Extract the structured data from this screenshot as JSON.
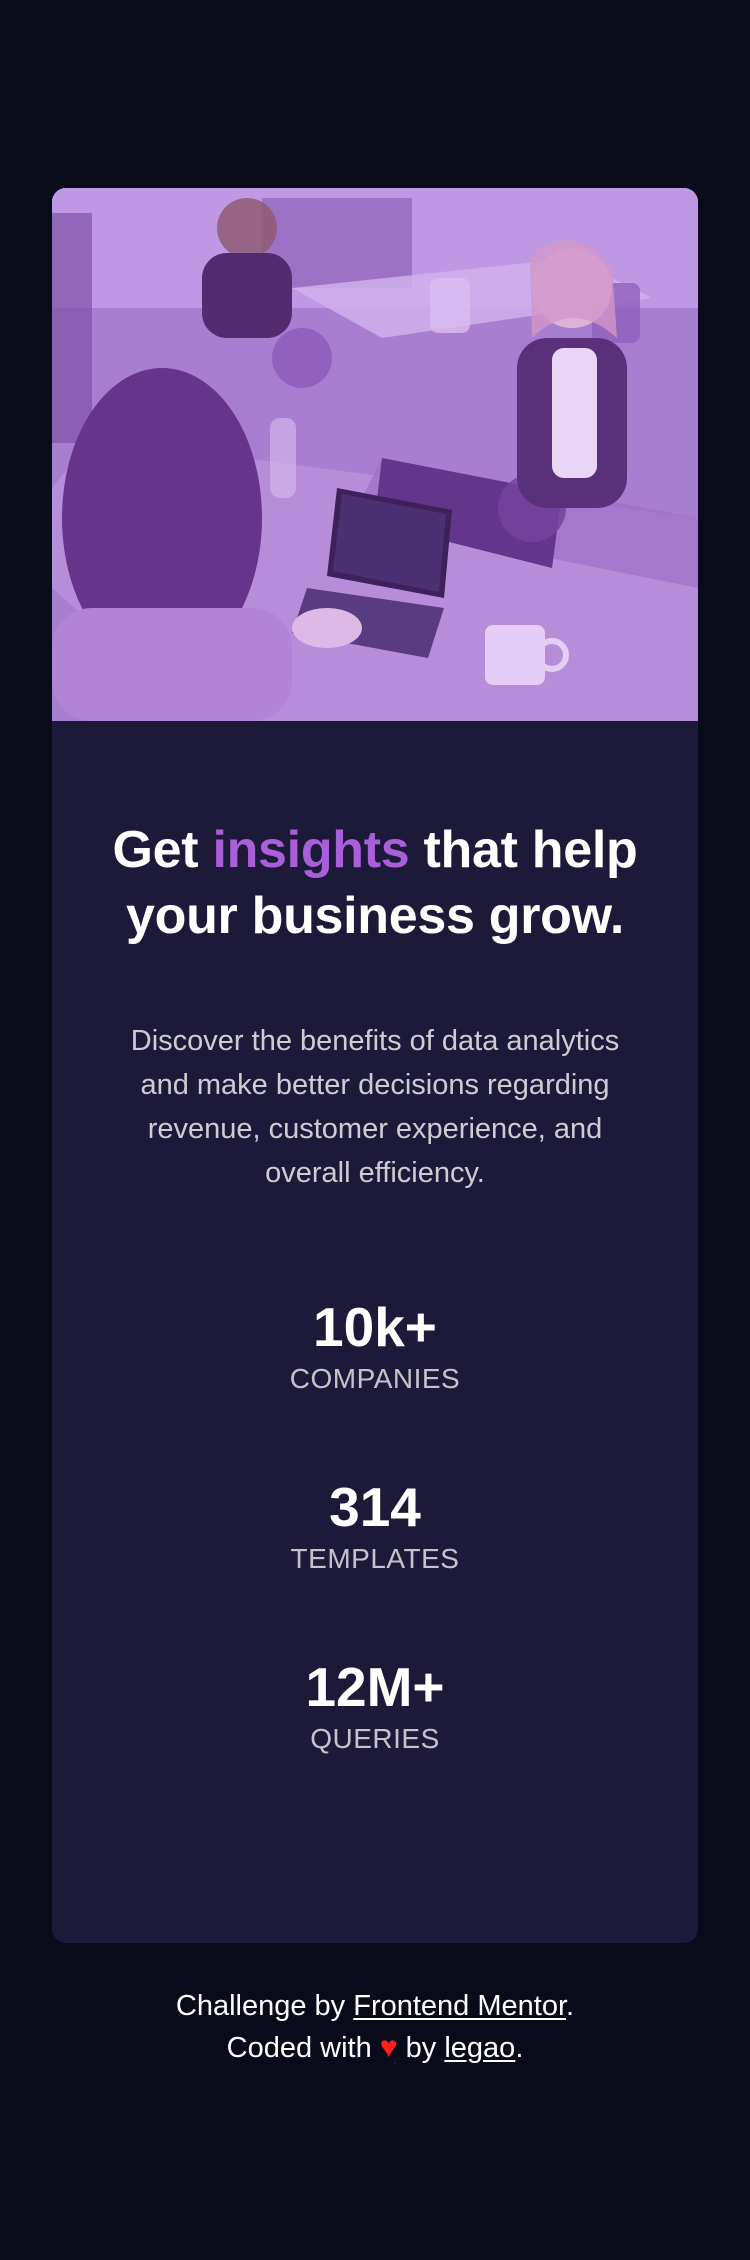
{
  "hero": {
    "image_alt": "Three people working at a table with laptops and plants"
  },
  "headline": {
    "part1": "Get ",
    "accent": "insights",
    "part2": " that help your business grow."
  },
  "description": "Discover the benefits of data analytics and make better decisions regarding revenue, customer experience, and overall efficiency.",
  "stats": [
    {
      "value": "10k+",
      "label": "COMPANIES"
    },
    {
      "value": "314",
      "label": "TEMPLATES"
    },
    {
      "value": "12M+",
      "label": "QUERIES"
    }
  ],
  "footer": {
    "line1_prefix": "Challenge by ",
    "line1_link": "Frontend Mentor",
    "line1_suffix": ".",
    "line2_prefix": "Coded with ",
    "heart": "♥",
    "line2_mid": " by ",
    "line2_link": "legao",
    "line2_suffix": "."
  },
  "colors": {
    "background": "#090b1a",
    "card": "#1c1a38",
    "accent": "#a95fd9",
    "heart": "#ff1e1e"
  }
}
